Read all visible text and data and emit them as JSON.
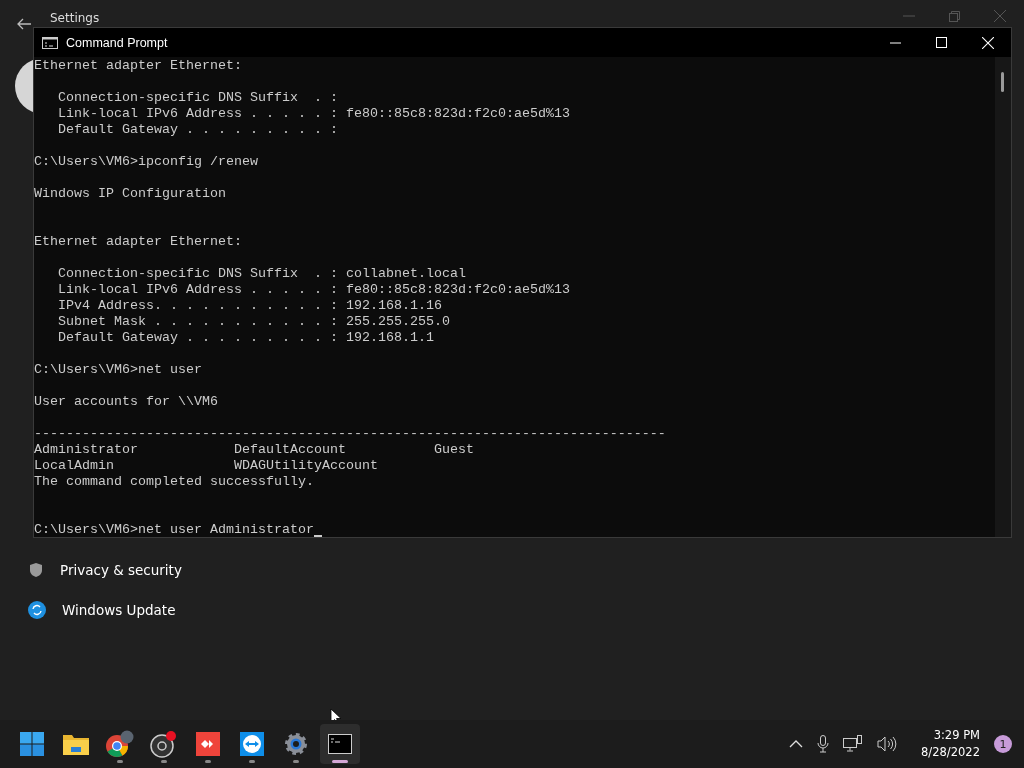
{
  "settings": {
    "title": "Settings",
    "sidebar_items": [
      {
        "label": "Privacy & security",
        "kind": "shield"
      },
      {
        "label": "Windows Update",
        "kind": "update"
      }
    ]
  },
  "console": {
    "title": "Command Prompt",
    "lines": [
      {
        "kind": "output",
        "text": "Ethernet adapter Ethernet:"
      },
      {
        "kind": "blank"
      },
      {
        "kind": "output",
        "text": "   Connection-specific DNS Suffix  . :"
      },
      {
        "kind": "output",
        "text": "   Link-local IPv6 Address . . . . . : fe80::85c8:823d:f2c0:ae5d%13"
      },
      {
        "kind": "output",
        "text": "   Default Gateway . . . . . . . . . :"
      },
      {
        "kind": "blank"
      },
      {
        "kind": "prompt",
        "text": "C:\\Users\\VM6>ipconfig /renew"
      },
      {
        "kind": "blank"
      },
      {
        "kind": "output",
        "text": "Windows IP Configuration"
      },
      {
        "kind": "blank"
      },
      {
        "kind": "blank"
      },
      {
        "kind": "output",
        "text": "Ethernet adapter Ethernet:"
      },
      {
        "kind": "blank"
      },
      {
        "kind": "output",
        "text": "   Connection-specific DNS Suffix  . : collabnet.local"
      },
      {
        "kind": "output",
        "text": "   Link-local IPv6 Address . . . . . : fe80::85c8:823d:f2c0:ae5d%13"
      },
      {
        "kind": "output",
        "text": "   IPv4 Address. . . . . . . . . . . : 192.168.1.16"
      },
      {
        "kind": "output",
        "text": "   Subnet Mask . . . . . . . . . . . : 255.255.255.0"
      },
      {
        "kind": "output",
        "text": "   Default Gateway . . . . . . . . . : 192.168.1.1"
      },
      {
        "kind": "blank"
      },
      {
        "kind": "prompt",
        "text": "C:\\Users\\VM6>net user"
      },
      {
        "kind": "blank"
      },
      {
        "kind": "output",
        "text": "User accounts for \\\\VM6"
      },
      {
        "kind": "blank"
      },
      {
        "kind": "output",
        "text": "-------------------------------------------------------------------------------"
      },
      {
        "kind": "output",
        "text": "Administrator            DefaultAccount           Guest"
      },
      {
        "kind": "output",
        "text": "LocalAdmin               WDAGUtilityAccount"
      },
      {
        "kind": "output",
        "text": "The command completed successfully."
      },
      {
        "kind": "blank"
      },
      {
        "kind": "blank"
      },
      {
        "kind": "input",
        "text": "C:\\Users\\VM6>net user Administrator"
      }
    ]
  },
  "taskbar": {
    "apps": [
      {
        "kind": "start",
        "running": false,
        "selected": false
      },
      {
        "kind": "folder",
        "running": false,
        "selected": false
      },
      {
        "kind": "chrome",
        "running": true,
        "selected": false
      },
      {
        "kind": "obs",
        "running": true,
        "selected": false
      },
      {
        "kind": "anydesk",
        "running": true,
        "selected": false
      },
      {
        "kind": "teamviewer",
        "running": true,
        "selected": false
      },
      {
        "kind": "gear",
        "running": true,
        "selected": false
      },
      {
        "kind": "terminal",
        "running": true,
        "selected": true
      }
    ],
    "time": "3:29 PM",
    "date": "8/28/2022",
    "notification_count": "1"
  }
}
